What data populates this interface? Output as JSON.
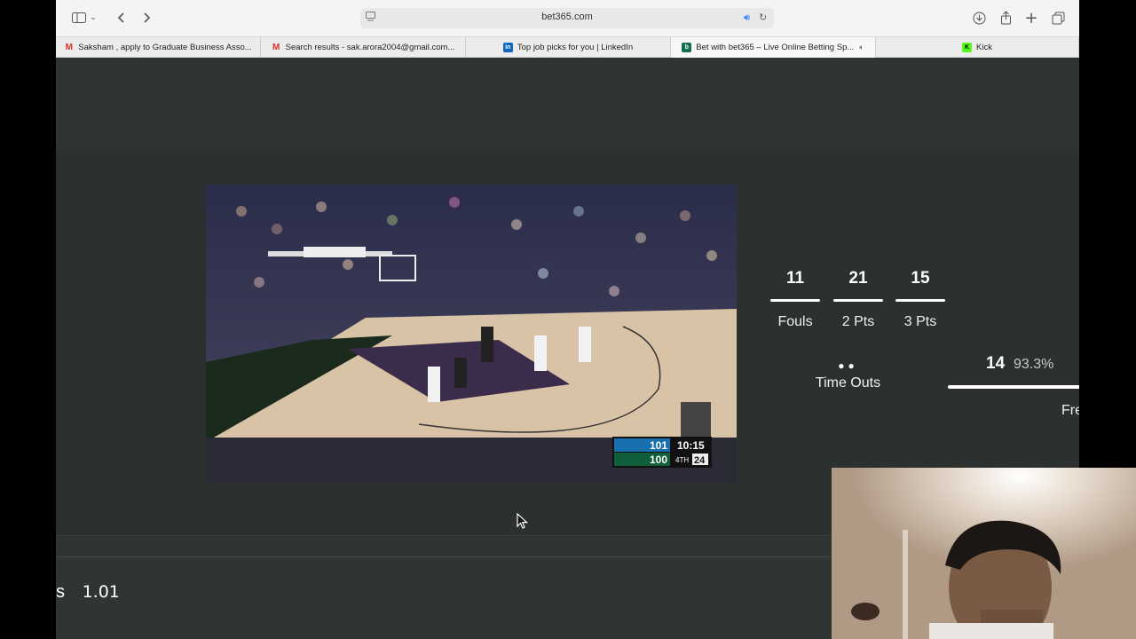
{
  "browser": {
    "url": "bet365.com",
    "tabs": [
      {
        "label": "Saksham , apply to Graduate Business Asso...",
        "icon": "gmail-icon",
        "active": false
      },
      {
        "label": "Search results - sak.arora2004@gmail.com...",
        "icon": "gmail-icon",
        "active": false
      },
      {
        "label": "Top job picks for you | LinkedIn",
        "icon": "linkedin-icon",
        "active": false
      },
      {
        "label": "Bet with bet365 – Live Online Betting Sp...",
        "icon": "bet365-icon",
        "active": true
      },
      {
        "label": "Kick",
        "icon": "kick-icon",
        "active": false
      }
    ]
  },
  "video": {
    "scoreboard": {
      "home_score": "101",
      "away_score": "100",
      "clock": "10:15",
      "period": "4TH",
      "shot_clock": "24"
    }
  },
  "stats": {
    "fouls": {
      "value": "11",
      "label": "Fouls"
    },
    "two_pts": {
      "value": "21",
      "label": "2 Pts"
    },
    "three_pts": {
      "value": "15",
      "label": "3 Pts"
    },
    "timeouts": {
      "dots": "●●",
      "label": "Time Outs"
    },
    "free_throws": {
      "value": "14",
      "percent": "93.3%",
      "label": "Fre",
      "fill_percent": 93.3
    }
  },
  "odds": {
    "label_fragment": "s",
    "value": "1.01"
  },
  "colors": {
    "page_bg": "#2c302f",
    "band_bg": "#303533",
    "accent_white": "#ffffff"
  }
}
